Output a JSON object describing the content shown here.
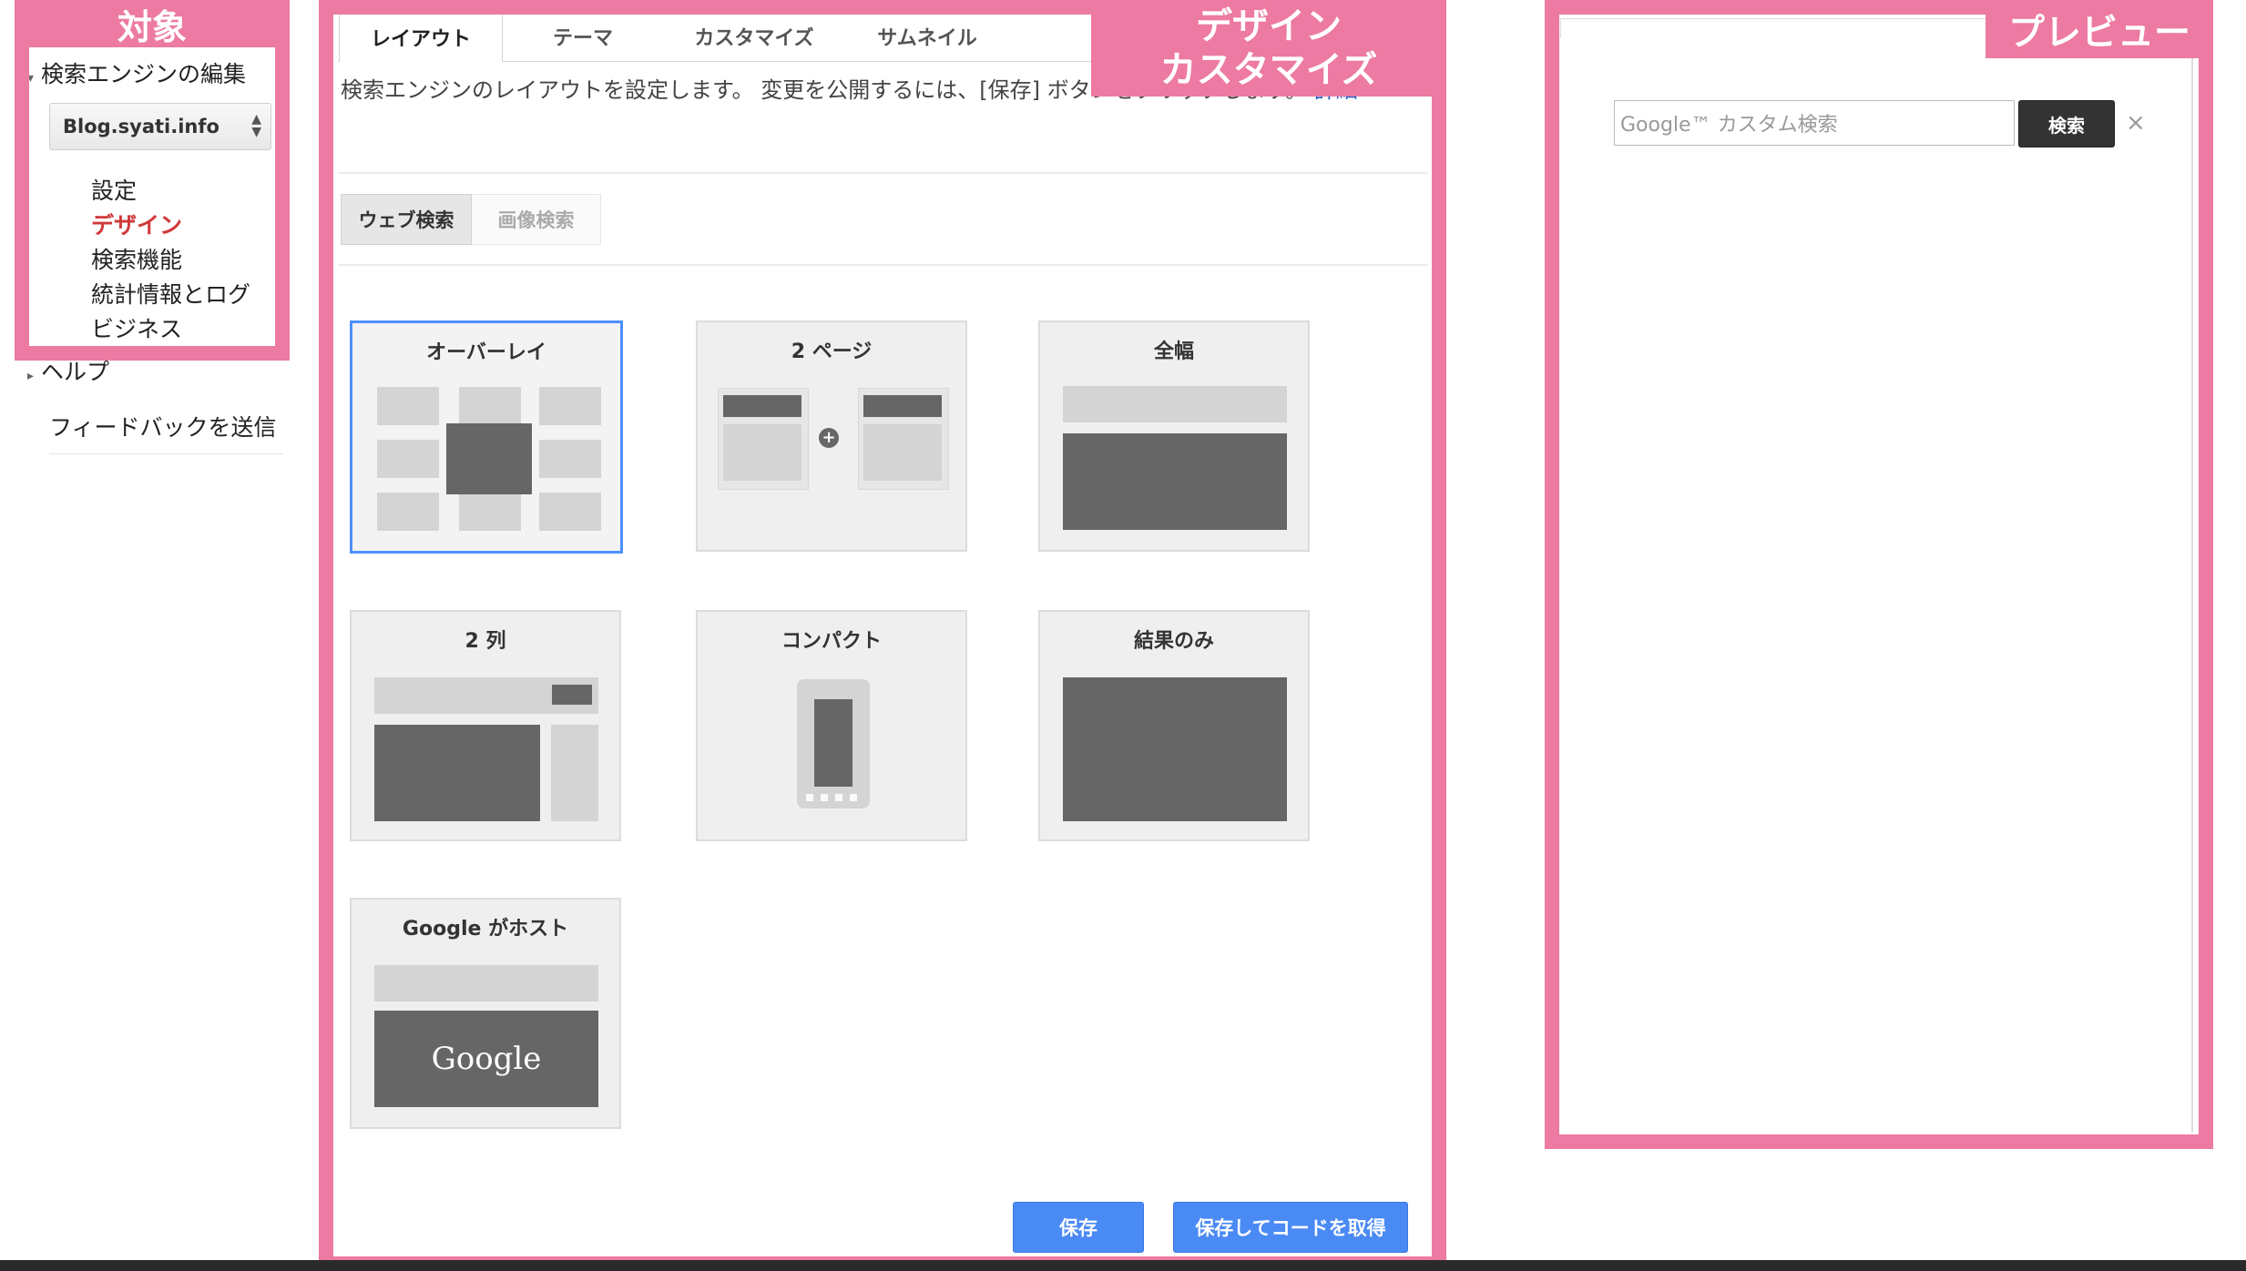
{
  "annotations": {
    "target": "対象",
    "design_line1": "デザイン",
    "design_line2": "カスタマイズ",
    "preview": "プレビュー"
  },
  "sidebar": {
    "section_title": "検索エンジンの編集",
    "engine_select": "Blog.syati.info",
    "nav": [
      "設定",
      "デザイン",
      "検索機能",
      "統計情報とログ",
      "ビジネス"
    ],
    "active_nav": "デザイン",
    "help": "ヘルプ",
    "feedback": "フィードバックを送信"
  },
  "tabs": [
    "レイアウト",
    "テーマ",
    "カスタマイズ",
    "サムネイル"
  ],
  "active_tab": "レイアウト",
  "description": {
    "text": "検索エンジンのレイアウトを設定します。 変更を公開するには、[保存] ボタンをクリックします。",
    "link": "詳細"
  },
  "search_type": {
    "web": "ウェブ検索",
    "image": "画像検索",
    "active": "ウェブ検索"
  },
  "layouts": [
    {
      "name": "オーバーレイ",
      "selected": true
    },
    {
      "name": "2 ページ",
      "selected": false
    },
    {
      "name": "全幅",
      "selected": false
    },
    {
      "name": "2 列",
      "selected": false
    },
    {
      "name": "コンパクト",
      "selected": false
    },
    {
      "name": "結果のみ",
      "selected": false
    },
    {
      "name": "Google がホスト",
      "selected": false
    }
  ],
  "hosted_logo": "Google",
  "buttons": {
    "save": "保存",
    "save_get_code": "保存してコードを取得"
  },
  "preview": {
    "placeholder": "Google™ カスタム検索",
    "search_button": "検索",
    "clear": "×"
  },
  "colors": {
    "annotation": "#ec7aa2",
    "active_nav": "#d0393a",
    "selected_border": "#4d90fe",
    "primary_button": "#4a8af4",
    "link": "#1a5bc7"
  }
}
